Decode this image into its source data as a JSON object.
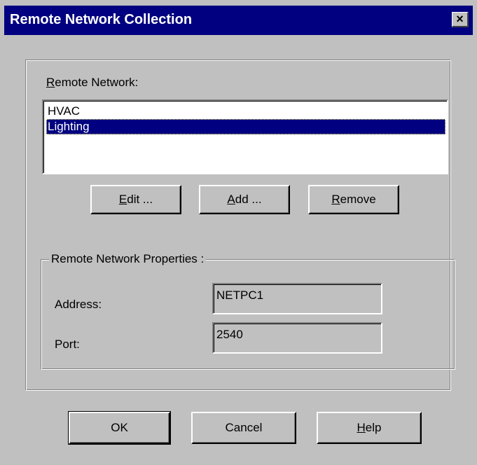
{
  "window": {
    "title": "Remote Network Collection",
    "close_label": "×"
  },
  "remote_network": {
    "label_prefix": "R",
    "label_rest": "emote Network:",
    "items": [
      {
        "label": "HVAC",
        "selected": false
      },
      {
        "label": "Lighting",
        "selected": true
      }
    ]
  },
  "list_buttons": {
    "edit_mnemonic": "E",
    "edit_rest": "dit ...",
    "add_mnemonic": "A",
    "add_rest": "dd ...",
    "remove_mnemonic": "R",
    "remove_rest": "emove"
  },
  "properties": {
    "title": "Remote Network Properties :",
    "address_label": "Address:",
    "address_value": "NETPC1",
    "port_label": "Port:",
    "port_value": "2540"
  },
  "dialog_buttons": {
    "ok_label": "OK",
    "cancel_label": "Cancel",
    "help_mnemonic": "H",
    "help_rest": "elp"
  },
  "colors": {
    "titlebar": "#000080",
    "face": "#c0c0c0",
    "selection": "#000080"
  }
}
